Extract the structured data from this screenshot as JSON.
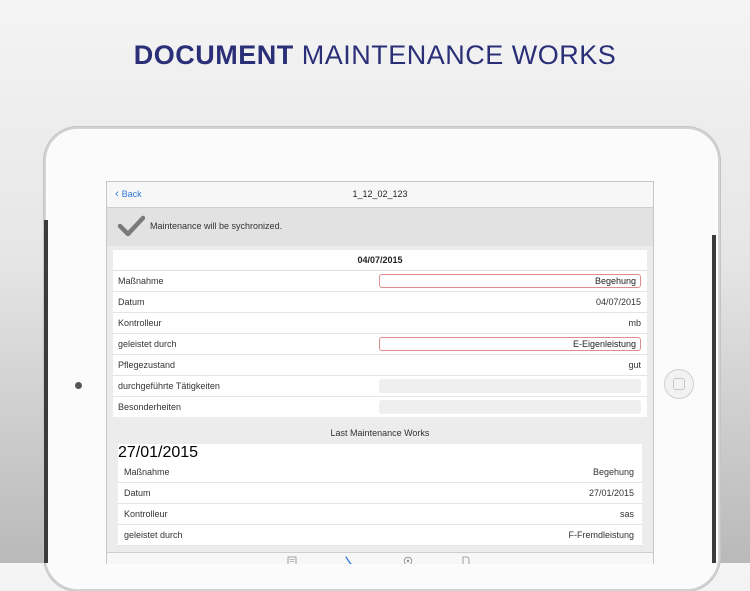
{
  "headline": {
    "bold": "DOCUMENT",
    "light": "MAINTENANCE WORKS"
  },
  "navbar": {
    "back_label": "Back",
    "title": "1_12_02_123"
  },
  "sync": {
    "message": "Maintenance will be sychronized."
  },
  "current": {
    "date": "04/07/2015",
    "rows": [
      {
        "label": "Maßnahme",
        "value": "Begehung"
      },
      {
        "label": "Datum",
        "value": "04/07/2015"
      },
      {
        "label": "Kontrolleur",
        "value": "mb"
      },
      {
        "label": "geleistet durch",
        "value": "E-Eigenleistung"
      },
      {
        "label": "Pflegezustand",
        "value": "gut"
      },
      {
        "label": "durchgeführte Tätigkeiten",
        "value": ""
      },
      {
        "label": "Besonderheiten",
        "value": ""
      }
    ]
  },
  "last": {
    "title": "Last Maintenance Works",
    "date": "27/01/2015",
    "rows": [
      {
        "label": "Maßnahme",
        "value": "Begehung"
      },
      {
        "label": "Datum",
        "value": "27/01/2015"
      },
      {
        "label": "Kontrolleur",
        "value": "sas"
      },
      {
        "label": "geleistet durch",
        "value": "F-Fremdleistung"
      }
    ]
  },
  "tabs": [
    {
      "icon": "list-icon"
    },
    {
      "icon": "wrench-icon"
    },
    {
      "icon": "compass-icon"
    },
    {
      "icon": "document-icon"
    }
  ],
  "colors": {
    "headline": "#2a2f78",
    "link": "#2f7bdc",
    "required_border": "#e08b8b"
  }
}
